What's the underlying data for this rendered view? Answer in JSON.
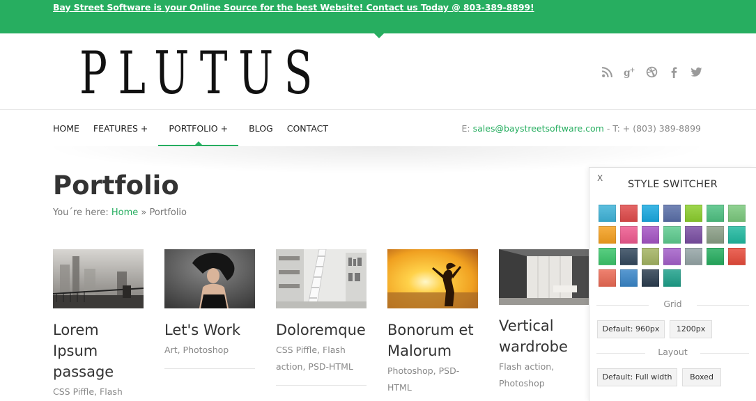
{
  "topbar": {
    "text": "Bay Street Software is your Online Source for the best Website! Contact us Today @ 803-389-8899!"
  },
  "logo": {
    "text": "PLUTUS"
  },
  "social": {
    "icons": [
      "rss-icon",
      "google-plus-icon",
      "dribbble-icon",
      "facebook-icon",
      "twitter-icon"
    ]
  },
  "nav": {
    "items": [
      "HOME",
      "FEATURES +",
      "PORTFOLIO +",
      "BLOG",
      "CONTACT"
    ],
    "active": "PORTFOLIO +",
    "contact_prefix": "E: ",
    "email": "sales@baystreetsoftware.com",
    "phone_text": " - T: + (803) 389-8899"
  },
  "page": {
    "title": "Portfolio",
    "breadcrumb_prefix": "You´re here: ",
    "breadcrumb_home": "Home",
    "breadcrumb_sep": " » ",
    "breadcrumb_current": "Portfolio"
  },
  "portfolio": [
    {
      "title": "Lorem Ipsum passage",
      "categories": "CSS Piffle, Flash"
    },
    {
      "title": "Let's Work",
      "categories": "Art, Photoshop"
    },
    {
      "title": "Doloremque",
      "categories": "CSS Piffle, Flash action, PSD-HTML"
    },
    {
      "title": "Bonorum et Malorum",
      "categories": "Photoshop, PSD-HTML"
    },
    {
      "title": "Vertical wardrobe",
      "categories": "Flash action, Photoshop"
    }
  ],
  "switcher": {
    "close": "X",
    "title": "STYLE SWITCHER",
    "colors": [
      "#3fb3d8",
      "#e04b4b",
      "#1aa9e0",
      "#5a6fa8",
      "#8cce2e",
      "#4fc182",
      "#7cc97e",
      "#f5a020",
      "#ee5a8f",
      "#a555c4",
      "#5ecb8f",
      "#7b4fa3",
      "#8a9e86",
      "#21b9a0",
      "#3cc56b",
      "#34495e",
      "#a4b463",
      "#a460c9",
      "#95a5a6",
      "#27ae60",
      "#e74c3c",
      "#ea6a55",
      "#3a86c8",
      "#2c3e50",
      "#1fa08a"
    ],
    "grid_label": "Grid",
    "grid_options": [
      "Default: 960px",
      "1200px"
    ],
    "layout_label": "Layout",
    "layout_options": [
      "Default: Full width",
      "Boxed"
    ]
  },
  "brand_color": "#27ae60"
}
